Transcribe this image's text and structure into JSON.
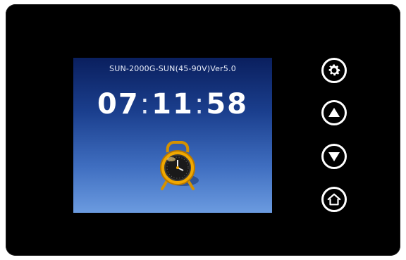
{
  "screen": {
    "model_text": "SUN-2000G-SUN(45-90V)Ver5.0",
    "clock": {
      "hours": "07",
      "minutes": "11",
      "seconds": "58",
      "separator": ":"
    },
    "icon": "alarm-clock-icon"
  },
  "buttons": [
    {
      "name": "settings",
      "icon": "gear-icon"
    },
    {
      "name": "up",
      "icon": "up-arrow-icon"
    },
    {
      "name": "down",
      "icon": "down-arrow-icon"
    },
    {
      "name": "home",
      "icon": "home-icon"
    }
  ],
  "colors": {
    "bezel": "#000000",
    "screen_top": "#0a1f5e",
    "screen_bottom": "#6b9be0",
    "alarm_body": "#f0a800",
    "button_outline": "#ffffff"
  }
}
